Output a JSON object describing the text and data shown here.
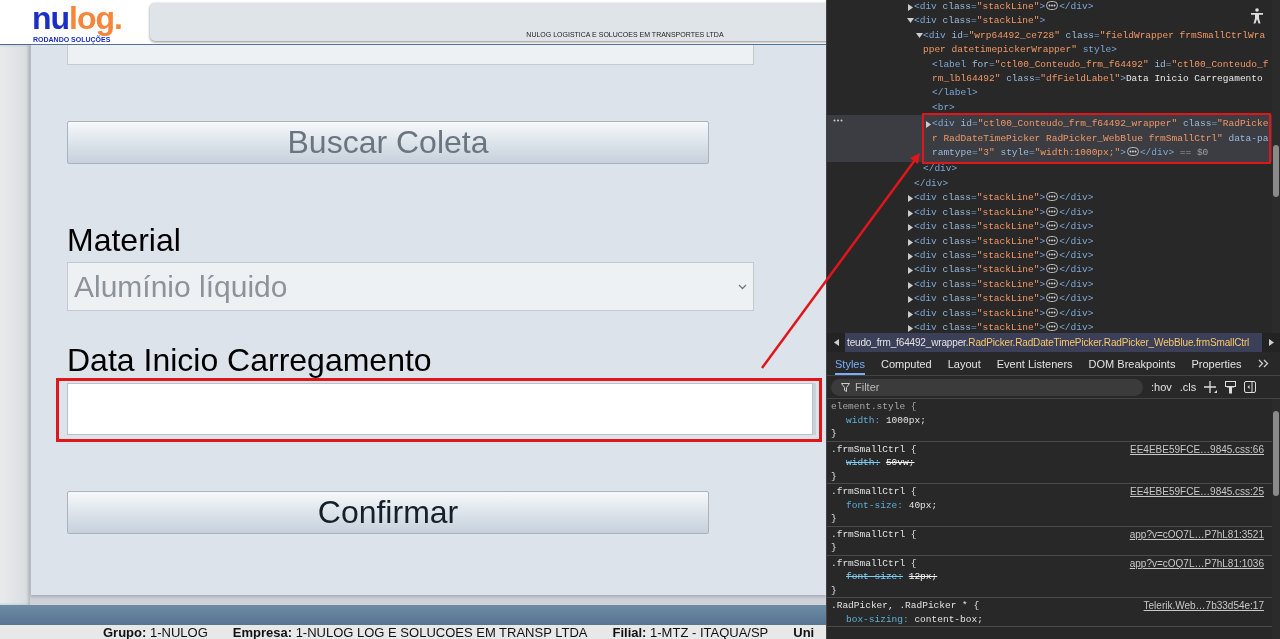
{
  "app": {
    "header": {
      "logo_parts": [
        "nu",
        "log."
      ],
      "tagline": "RODANDO SOLUÇÕES",
      "company": "NULOG LOGISTICA E SOLUCOES EM TRANSPORTES LTDA"
    },
    "form": {
      "items": [
        {
          "kind": "field"
        },
        {
          "kind": "button",
          "label": "Buscar Coleta",
          "disabled": true
        },
        {
          "kind": "select",
          "label": "Material",
          "value": "Alumínio líquido",
          "disabled": true
        },
        {
          "kind": "date",
          "label": "Data Inicio Carregamento",
          "highlighted": true
        },
        {
          "kind": "button",
          "label": "Confirmar",
          "disabled": false
        }
      ]
    },
    "footer": [
      {
        "label": "Grupo:",
        "value": "1-NULOG"
      },
      {
        "label": "Empresa:",
        "value": "1-NULOG LOG E SOLUCOES EM TRANSP LTDA"
      },
      {
        "label": "Filial:",
        "value": "1-MTZ - ITAQUA/SP"
      },
      {
        "label": "Uni"
      }
    ]
  },
  "annotation": {
    "arrow": true
  },
  "devtools": {
    "tree": [
      {
        "open": "<div class=\"stackLine\">",
        "close": "</div>",
        "expanded": false,
        "selected": false
      },
      {
        "open": "<div class=\"stackLine\">",
        "close": "</div>",
        "expanded": true,
        "selected": false,
        "children": [
          {
            "open": "<div id=\"wrp64492_ce728\" class=\"fieldWrapper frmSmallCtrlWrapper datetimepickerWrapper\" style>",
            "close": "</div>",
            "expanded": true,
            "selected": false,
            "children": [
              {
                "open": "<label for=\"ctl00_Conteudo_frm_f64492\" id=\"ctl00_Conteudo_frm_lbl64492\" class=\"dfFieldLabel\">",
                "content": "Data Inicio Carregamento",
                "close": "</label>",
                "selected": false
              },
              {
                "open": "<br>",
                "selected": false
              },
              {
                "open": "<div id=\"ctl00_Conteudo_frm_f64492_wrapper\" class=\"RadPicker RadDateTimePicker RadPicker_WebBlue frmSmallCtrl\" data-paramtype=\"3\" style=\"width:1000px;\">",
                "close": "</div>",
                "console_ref": "== $0",
                "expanded": false,
                "selected": true,
                "highlighted": true
              }
            ]
          }
        ]
      },
      {
        "open": "<div class=\"stackLine\">",
        "close": "</div>",
        "expanded": false,
        "selected": false
      },
      {
        "open": "<div class=\"stackLine\">",
        "close": "</div>",
        "expanded": false,
        "selected": false
      },
      {
        "open": "<div class=\"stackLine\">",
        "close": "</div>",
        "expanded": false,
        "selected": false
      },
      {
        "open": "<div class=\"stackLine\">",
        "close": "</div>",
        "expanded": false,
        "selected": false
      },
      {
        "open": "<div class=\"stackLine\">",
        "close": "</div>",
        "expanded": false,
        "selected": false
      },
      {
        "open": "<div class=\"stackLine\">",
        "close": "</div>",
        "expanded": false,
        "selected": false
      },
      {
        "open": "<div class=\"stackLine\">",
        "close": "</div>",
        "expanded": false,
        "selected": false
      },
      {
        "open": "<div class=\"stackLine\">",
        "close": "</div>",
        "expanded": false,
        "selected": false
      },
      {
        "open": "<div class=\"stackLine\">",
        "close": "</div>",
        "expanded": false,
        "selected": false
      },
      {
        "open": "<div class=\"stackLine\">",
        "close": "</div>",
        "expanded": false,
        "selected": false
      }
    ],
    "breadcrumb": {
      "id_part": "teudo_frm_f64492_wrapper",
      "class_part": ".RadPicker.RadDateTimePicker.RadPicker_WebBlue.frmSmallCtrl"
    },
    "tabs": [
      {
        "label": "Styles",
        "selected": true
      },
      {
        "label": "Computed",
        "selected": false
      },
      {
        "label": "Layout",
        "selected": false
      },
      {
        "label": "Event Listeners",
        "selected": false
      },
      {
        "label": "DOM Breakpoints",
        "selected": false
      },
      {
        "label": "Properties",
        "selected": false
      }
    ],
    "filter": {
      "placeholder": "Filter"
    },
    "tools": [
      ":hov",
      ".cls"
    ],
    "rules": [
      {
        "kind": "inline",
        "selector": "element.style {",
        "close": "}",
        "props": [
          {
            "name": "width:",
            "value": "1000px;",
            "overridden": false
          }
        ]
      },
      {
        "kind": "stylesheet",
        "selector": ".frmSmallCtrl {",
        "source": "EE4EBE59FCE…9845.css:66",
        "close": "}",
        "props": [
          {
            "name": "width:",
            "value": "50vw;",
            "overridden": true
          }
        ]
      },
      {
        "kind": "stylesheet",
        "selector": ".frmSmallCtrl {",
        "source": "EE4EBE59FCE…9845.css:25",
        "close": "}",
        "props": [
          {
            "name": "font-size:",
            "value": "40px;",
            "overridden": false
          }
        ]
      },
      {
        "kind": "stylesheet",
        "selector": ".frmSmallCtrl {",
        "source": "app?v=cOQ7L…P7hL81:3521",
        "close": "}"
      },
      {
        "kind": "stylesheet",
        "selector": ".frmSmallCtrl {",
        "source": "app?v=cOQ7L…P7hL81:1036",
        "close": "}",
        "props": [
          {
            "name": "font-size:",
            "value": "12px;",
            "overridden": true
          }
        ]
      },
      {
        "kind": "stylesheet",
        "selector": ".RadPicker, .RadPicker * {",
        "source": "Telerik.Web…7b33d54e:17",
        "props": [
          {
            "name": "box-sizing:",
            "value": "content-box;",
            "overridden": false
          }
        ]
      }
    ]
  }
}
